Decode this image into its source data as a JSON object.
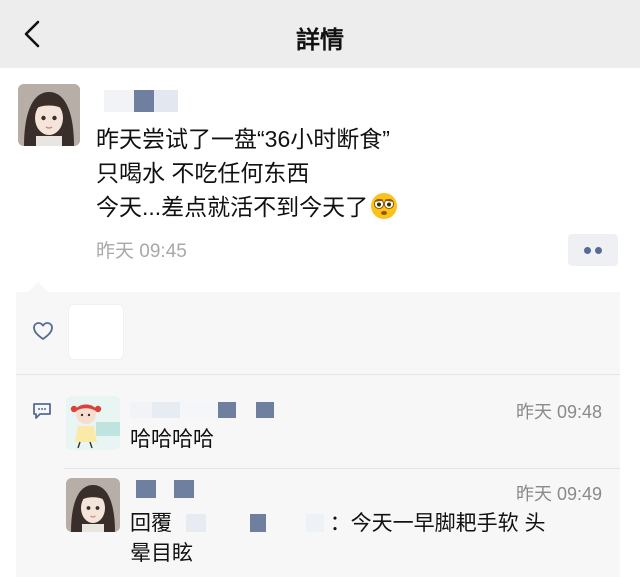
{
  "nav": {
    "title": "詳情",
    "back_icon": "chevron-left-icon"
  },
  "post": {
    "lines": [
      "昨天尝试了一盘“36小时断食”",
      "只喝水 不吃任何东西",
      "今天...差点就活不到今天了"
    ],
    "emoji": "dizzy-face-emoji",
    "time": "昨天 09:45",
    "more_icon": "more-dots-icon",
    "accent_color": "#576b95"
  },
  "likes": {
    "icon": "heart-outline-icon"
  },
  "comments": [
    {
      "text": "哈哈哈哈",
      "time": "昨天 09:48"
    },
    {
      "reply_label": "回覆",
      "text_tail": "：今天一早脚耙手软 头",
      "text_line2": "晕目眩",
      "time": "昨天 09:49"
    }
  ]
}
